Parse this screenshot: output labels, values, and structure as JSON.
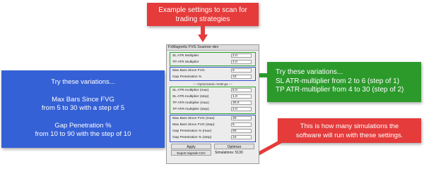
{
  "callouts": {
    "top": {
      "lines": [
        "Example settings to scan for",
        "trading strategies"
      ],
      "color": "#e53b3b"
    },
    "left": {
      "heading": "Try these variations...",
      "lines1": [
        "Max Bars Since FVG",
        "from 5 to 30 with a step of 5"
      ],
      "lines2": [
        "Gap Penetration %",
        "from 10 to 90 with the step of 10"
      ],
      "color": "#3561d6"
    },
    "right": {
      "lines": [
        "Try these variations...",
        "SL ATR-multiplier from 2 to 6 (step of 1)",
        "TP ATR-multiplier from 4 to 30 (step of 2)"
      ],
      "color": "#2b9a2b"
    },
    "bottom_right": {
      "lines": [
        "This is how many simulations the",
        "software will run with these settings."
      ],
      "color": "#e53b3b"
    }
  },
  "panel": {
    "title": "FxMagnetic FVG Scanner-dev",
    "settings": [
      {
        "label": "SL ATR Multiplier",
        "value": "2.0"
      },
      {
        "label": "TP ATR Multiplier",
        "value": "4.0"
      },
      {
        "label": "Max Bars Since FVG",
        "value": "5"
      },
      {
        "label": "Gap Penetration %",
        "value": "10"
      }
    ],
    "separator": "— Optimization Settings —",
    "optimization": [
      {
        "label": "SL ATR-multiplier (max)",
        "value": "6.0"
      },
      {
        "label": "SL ATR-multiplier (step)",
        "value": "1.0"
      },
      {
        "label": "TP ATR-multiplier (max)",
        "value": "30.0"
      },
      {
        "label": "TP ATR-multiplier (step)",
        "value": "2.0"
      },
      {
        "label": "Max Bars Since FVG (max)",
        "value": "30"
      },
      {
        "label": "Max Bars Since FVG (step)",
        "value": "5"
      },
      {
        "label": "Gap Penetration % (max)",
        "value": "90"
      },
      {
        "label": "Gap Penetration % (step)",
        "value": "10"
      }
    ],
    "buttons": {
      "apply": "Apply",
      "optimize": "Optimize",
      "export": "Export Signals CSV"
    },
    "simulations": "Simulations: 5130"
  }
}
